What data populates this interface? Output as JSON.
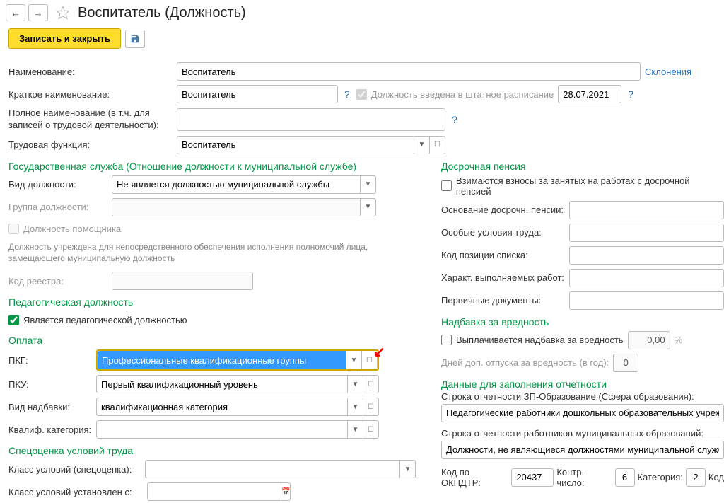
{
  "header": {
    "title": "Воспитатель (Должность)",
    "save_close": "Записать и закрыть"
  },
  "main": {
    "name_label": "Наименование:",
    "name_value": "Воспитатель",
    "decline_link": "Склонения",
    "short_label": "Краткое наименование:",
    "short_value": "Воспитатель",
    "in_staff_label": "Должность введена в штатное расписание",
    "in_staff_date": "28.07.2021",
    "full_label": "Полное наименование (в т.ч. для записей о трудовой деятельности):",
    "job_func_label": "Трудовая функция:",
    "job_func_value": "Воспитатель"
  },
  "gov": {
    "title": "Государственная служба (Отношение должности к муниципальной службе)",
    "type_label": "Вид должности:",
    "type_value": "Не является должностью муниципальной службы",
    "group_label": "Группа должности:",
    "helper_label": "Должность помощника",
    "helper_desc": "Должность учреждена для непосредственного обеспечения исполнения полномочий лица, замещающего муниципальную должность",
    "registry_label": "Код реестра:"
  },
  "ped": {
    "title": "Педагогическая должность",
    "is_ped_label": "Является педагогической должностью"
  },
  "pay": {
    "title": "Оплата",
    "pkg_label": "ПКГ:",
    "pkg_value": "Профессиональные квалификационные группы",
    "pku_label": "ПКУ:",
    "pku_value": "Первый квалификационный уровень",
    "addon_label": "Вид надбавки:",
    "addon_value": "квалификационная категория",
    "qual_label": "Квалиф. категория:"
  },
  "sout": {
    "title": "Спецоценка условий труда",
    "class_label": "Класс условий (спецоценка):",
    "class_set_label": "Класс условий установлен с:"
  },
  "pension": {
    "title": "Досрочная пенсия",
    "levied_label": "Взимаются взносы за занятых на работах с досрочной пенсией",
    "basis_label": "Основание досрочн. пенсии:",
    "cond_label": "Особые условия труда:",
    "code_label": "Код позиции списка:",
    "nature_label": "Характ. выполняемых работ:",
    "docs_label": "Первичные документы:"
  },
  "hazard": {
    "title": "Надбавка за вредность",
    "paid_label": "Выплачивается надбавка за вредность",
    "amount": "0,00",
    "days_label": "Дней доп. отпуска за вредность (в год):",
    "days_value": "0"
  },
  "report": {
    "title": "Данные для заполнения отчетности",
    "edu_label": "Строка отчетности ЗП-Образование (Сфера образования):",
    "edu_value": "Педагогические работники дошкольных образовательных учреждени",
    "mun_label": "Строка отчетности работников муниципальных образований:",
    "mun_value": "Должности, не являющиеся должностями муниципальной службы",
    "okpdtr_label": "Код по ОКПДТР:",
    "okpdtr_value": "20437",
    "check_label": "Контр. число:",
    "check_value": "6",
    "cat_label": "Категория:",
    "cat_value": "2",
    "kod_label": "Код"
  }
}
